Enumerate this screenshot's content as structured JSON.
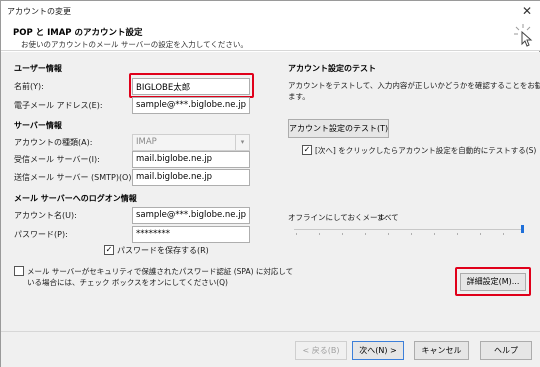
{
  "window": {
    "title": "アカウントの変更",
    "close_glyph": "✕"
  },
  "header": {
    "title": "POP と IMAP のアカウント設定",
    "subtitle": "お使いのアカウントのメール サーバーの設定を入力してください。"
  },
  "user_info": {
    "section": "ユーザー情報",
    "name_label": "名前(Y):",
    "name_value": "BIGLOBE太郎",
    "email_label": "電子メール アドレス(E):",
    "email_value": "sample@***.biglobe.ne.jp"
  },
  "server_info": {
    "section": "サーバー情報",
    "type_label": "アカウントの種類(A):",
    "type_value": "IMAP",
    "incoming_label": "受信メール サーバー(I):",
    "incoming_value": "mail.biglobe.ne.jp",
    "outgoing_label": "送信メール サーバー (SMTP)(O):",
    "outgoing_value": "mail.biglobe.ne.jp"
  },
  "logon_info": {
    "section": "メール サーバーへのログオン情報",
    "account_label": "アカウント名(U):",
    "account_value": "sample@***.biglobe.ne.jp",
    "password_label": "パスワード(P):",
    "password_value": "********",
    "remember_label": "パスワードを保存する(R)",
    "remember_checked": true,
    "spa_label_line1": "メール サーバーがセキュリティで保護されたパスワード認証 (SPA) に対応して",
    "spa_label_line2": "いる場合には、チェック ボックスをオンにしてください(Q)",
    "spa_checked": false
  },
  "test": {
    "section": "アカウント設定のテスト",
    "desc_line1": "アカウントをテストして、入力内容が正しいかどうかを確認することをお勧めし",
    "desc_line2": "ます。",
    "test_button": "アカウント設定のテスト(T)",
    "auto_test_label": "[次へ] をクリックしたらアカウント設定を自動的にテストする(S)",
    "auto_test_checked": true,
    "offline_label": "オフラインにしておくメール:",
    "offline_value": "すべて",
    "offline_level_fraction": 1.0
  },
  "more_settings_button": "詳細設定(M)...",
  "footer": {
    "back": "< 戻る(B)",
    "next": "次へ(N) >",
    "cancel": "キャンセル",
    "help": "ヘルプ"
  },
  "colors": {
    "highlight": "#e0001a",
    "slider_accent": "#1e6fd9"
  },
  "icons": [
    "close-icon",
    "cursor-sparkle-icon",
    "checkmark-icon",
    "chevron-down-icon"
  ]
}
